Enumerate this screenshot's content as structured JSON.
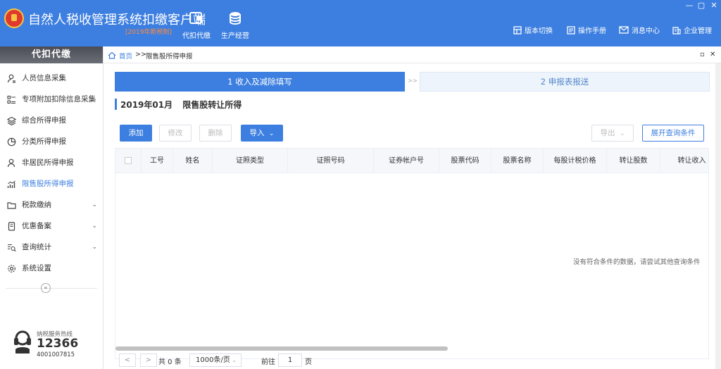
{
  "header": {
    "title": "自然人税收管理系统扣缴客户端",
    "subtitle": "[2019年新税制]",
    "nav": [
      {
        "label": "代扣代缴",
        "icon": "wallet-icon"
      },
      {
        "label": "生产经营",
        "icon": "coins-icon"
      }
    ],
    "tools": [
      {
        "label": "版本切换",
        "icon": "version-switch-icon"
      },
      {
        "label": "操作手册",
        "icon": "manual-icon"
      },
      {
        "label": "消息中心",
        "icon": "mail-icon"
      },
      {
        "label": "企业管理",
        "icon": "building-icon"
      }
    ],
    "window_controls": [
      "—",
      "▢",
      "✕"
    ],
    "brand_color": "#3d7fe0"
  },
  "sidebar": {
    "title": "代扣代缴",
    "items": [
      {
        "label": "人员信息采集",
        "icon": "user-info-icon",
        "chevron": ""
      },
      {
        "label": "专项附加扣除信息采集",
        "icon": "list-icon",
        "chevron": "⌄"
      },
      {
        "label": "综合所得申报",
        "icon": "layers-icon",
        "chevron": ""
      },
      {
        "label": "分类所得申报",
        "icon": "pie-icon",
        "chevron": ""
      },
      {
        "label": "非居民所得申报",
        "icon": "person-icon",
        "chevron": ""
      },
      {
        "label": "限售股所得申报",
        "icon": "bar-chart-icon",
        "chevron": "",
        "active": true
      },
      {
        "label": "税款缴纳",
        "icon": "folder-icon",
        "chevron": "⌄"
      },
      {
        "label": "优惠备案",
        "icon": "document-icon",
        "chevron": "⌄"
      },
      {
        "label": "查询统计",
        "icon": "search-list-icon",
        "chevron": "⌄"
      },
      {
        "label": "系统设置",
        "icon": "gear-icon",
        "chevron": ""
      }
    ],
    "collapse": "«",
    "hotline_label": "纳税服务热线",
    "hotline_number": "12366",
    "hotline_alt": "4001007815"
  },
  "breadcrumb": {
    "home": "首页",
    "separator": ">>",
    "current": "限售股所得申报",
    "controls": [
      "▫",
      "✕"
    ]
  },
  "steps": {
    "step1": "1 收入及减除填写",
    "arrow": ">>",
    "step2": "2 申报表报送"
  },
  "section": {
    "period": "2019年01月",
    "title": "限售股转让所得"
  },
  "toolbar": {
    "add": "添加",
    "edit": "修改",
    "delete": "删除",
    "import": "导入",
    "export": "导出",
    "expand_query": "展开查询条件"
  },
  "table": {
    "columns": [
      "工号",
      "姓名",
      "证照类型",
      "证照号码",
      "证券帐户号",
      "股票代码",
      "股票名称",
      "每股计税价格",
      "转让股数",
      "转让收入"
    ],
    "rows": [],
    "empty_text": "没有符合条件的数据，请尝试其他查询条件"
  },
  "pagination": {
    "prev": "<",
    "next": ">",
    "total": "共 0 条",
    "page_size": "1000条/页",
    "goto_prefix": "前往",
    "page": "1",
    "goto_suffix": "页"
  }
}
